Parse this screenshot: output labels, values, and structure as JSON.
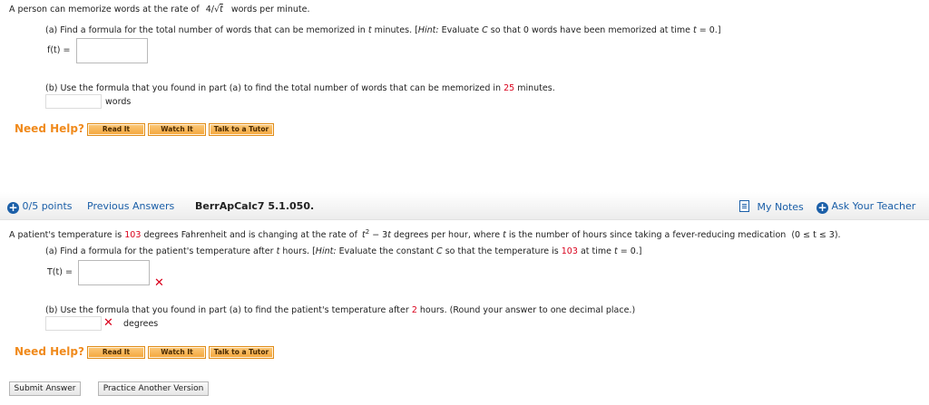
{
  "q1": {
    "intro_pre": "A person can memorize words at the rate of",
    "rate_num": "4/",
    "rate_sqrt": "√",
    "rate_var": "t",
    "intro_post": "words per minute.",
    "part_a_pre": "(a) Find a formula for the total number of words that can be memorized in",
    "part_a_t": "t",
    "part_a_mid": "minutes. [",
    "part_a_hint": "Hint:",
    "part_a_hint_text": "Evaluate",
    "part_a_C": "C",
    "part_a_rest": "so that 0 words have been memorized at time",
    "part_a_t2": "t",
    "part_a_end": "= 0.]",
    "f_label": "f(t) =",
    "f_value": "",
    "part_b_pre": "(b) Use the formula that you found in part (a) to find the total number of words that can be memorized in",
    "part_b_num": "25",
    "part_b_post": "minutes.",
    "words_value": "",
    "words_label": "words",
    "need_help": "Need Help?",
    "btn_read": "Read It",
    "btn_watch": "Watch It",
    "btn_tutor": "Talk to a Tutor"
  },
  "q2_header": {
    "points": "0/5 points",
    "previous": "Previous Answers",
    "code": "BerrApCalc7 5.1.050.",
    "my_notes": "My Notes",
    "ask_teacher": "Ask Your Teacher"
  },
  "q2": {
    "intro_pre": "A patient's temperature is",
    "temp": "103",
    "intro_mid": "degrees Fahrenheit and is changing at the rate of",
    "rate_t": "t",
    "rate_exp": "2",
    "rate_rest": "− 3",
    "rate_t2": "t",
    "intro_post": "degrees per hour, where",
    "intro_t": "t",
    "intro_end": "is the number of hours since taking a fever-reducing medication",
    "domain": "(0 ≤ t ≤ 3).",
    "part_a_pre": "(a) Find a formula for the patient's temperature after",
    "part_a_t": "t",
    "part_a_mid": "hours. [",
    "part_a_hint": "Hint:",
    "part_a_hint_text": "Evaluate the constant",
    "part_a_C": "C",
    "part_a_rest": "so that the temperature is",
    "part_a_temp": "103",
    "part_a_at": "at time",
    "part_a_t2": "t",
    "part_a_end": "= 0.]",
    "T_label": "T(t) =",
    "T_value": "",
    "part_b_pre": "(b) Use the formula that you found in part (a) to find the patient's temperature after",
    "part_b_num": "2",
    "part_b_post": "hours. (Round your answer to one decimal place.)",
    "deg_value": "",
    "deg_label": "degrees",
    "need_help": "Need Help?",
    "btn_read": "Read It",
    "btn_watch": "Watch It",
    "btn_tutor": "Talk to a Tutor"
  },
  "footer": {
    "submit": "Submit Answer",
    "practice": "Practice Another Version"
  },
  "colors": {
    "accent_orange": "#f08a1c",
    "link_blue": "#1b5fa8",
    "error_red": "#d9001b"
  },
  "icons": {
    "incorrect": "x-mark-icon",
    "add": "plus-circle-icon",
    "notes": "notes-icon"
  }
}
